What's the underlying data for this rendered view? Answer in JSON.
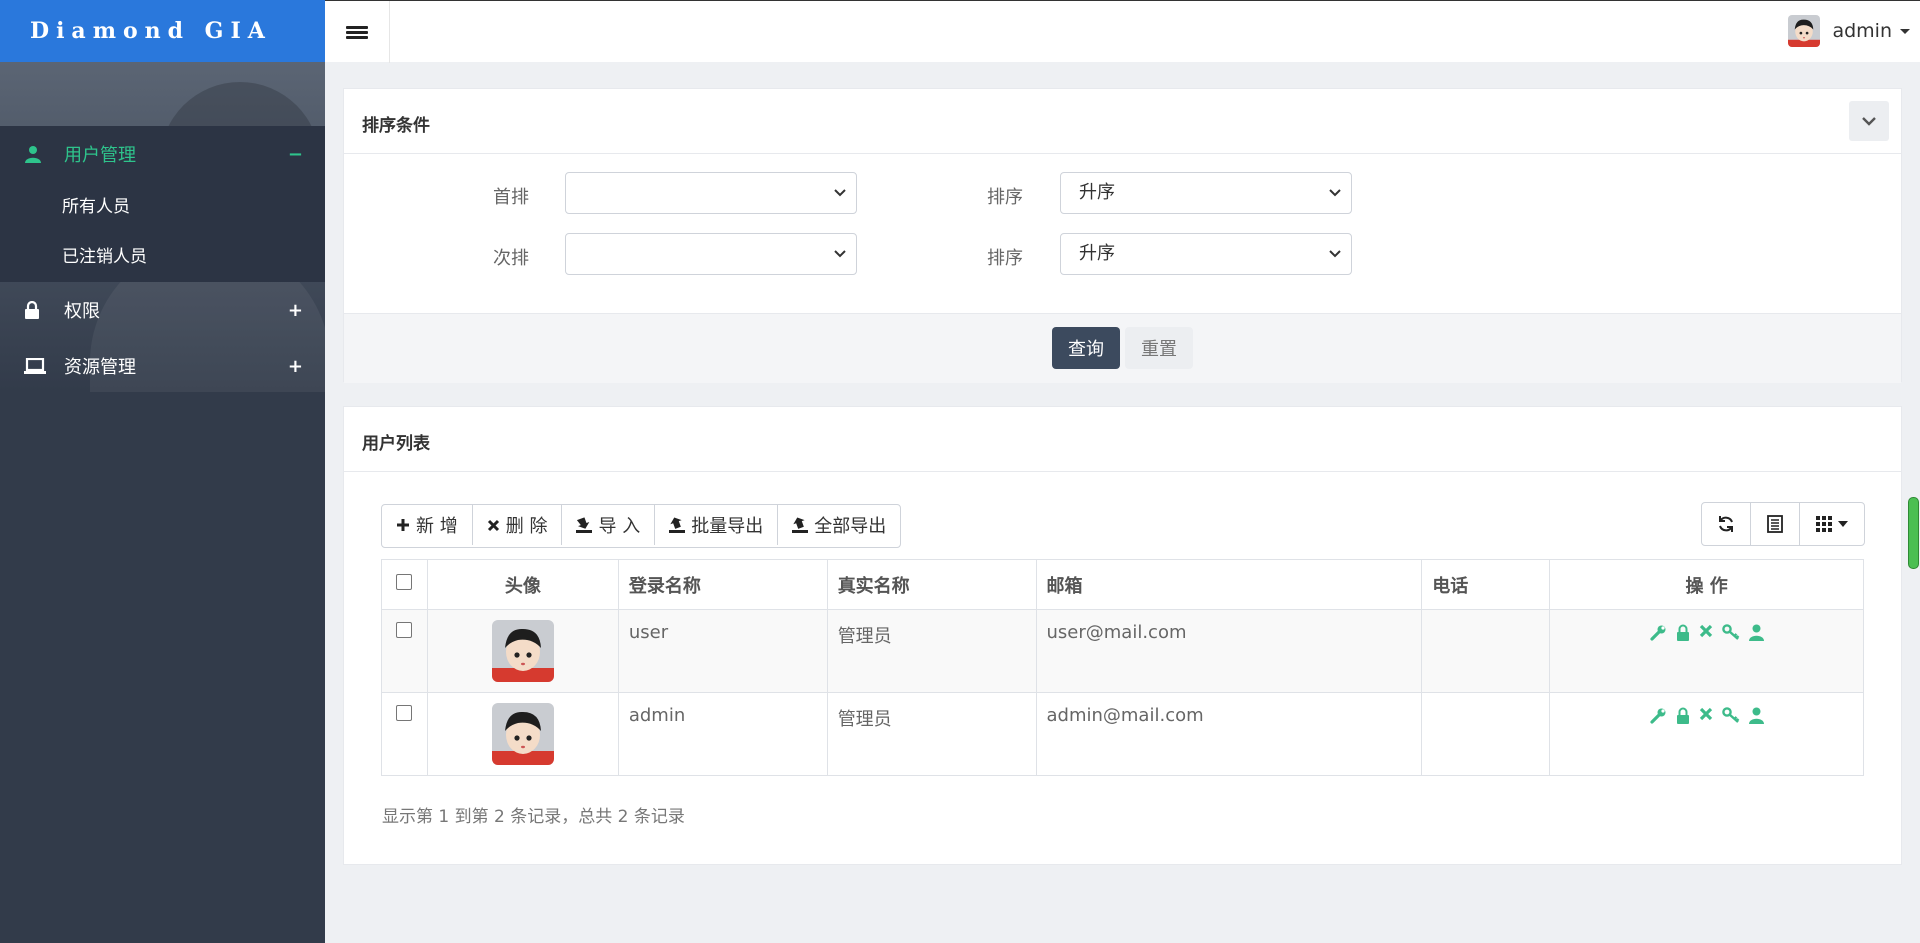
{
  "app": {
    "logo": "Diamond  GIA"
  },
  "header": {
    "username": "admin"
  },
  "sidebar": {
    "items": [
      {
        "label": "用户管理",
        "toggle": "−",
        "icon": "user-icon",
        "active": true,
        "children": [
          {
            "label": "所有人员"
          },
          {
            "label": "已注销人员"
          }
        ]
      },
      {
        "label": "权限",
        "toggle": "+",
        "icon": "lock-icon"
      },
      {
        "label": "资源管理",
        "toggle": "+",
        "icon": "laptop-icon"
      }
    ]
  },
  "sort_panel": {
    "title": "排序条件",
    "primary_label": "首排",
    "primary_value": "",
    "secondary_label": "次排",
    "secondary_value": "",
    "order_label_1": "排序",
    "order_value_1": "升序",
    "order_label_2": "排序",
    "order_value_2": "升序",
    "query_button": "查询",
    "reset_button": "重置"
  },
  "list_panel": {
    "title": "用户列表",
    "toolbar": {
      "add": "新 增",
      "delete": "删 除",
      "import": "导 入",
      "batch_export": "批量导出",
      "export_all": "全部导出"
    },
    "columns": {
      "avatar": "头像",
      "login_name": "登录名称",
      "real_name": "真实名称",
      "email": "邮箱",
      "phone": "电话",
      "actions": "操 作"
    },
    "rows": [
      {
        "login_name": "user",
        "real_name": "管理员",
        "email": "user@mail.com",
        "phone": ""
      },
      {
        "login_name": "admin",
        "real_name": "管理员",
        "email": "admin@mail.com",
        "phone": ""
      }
    ],
    "footer": "显示第 1 到第 2 条记录，总共 2 条记录"
  },
  "colors": {
    "brand": "#2a78dc",
    "sidebar": "#323b4a",
    "accent": "#2ec48c",
    "primary_button": "#3c4a5e"
  }
}
